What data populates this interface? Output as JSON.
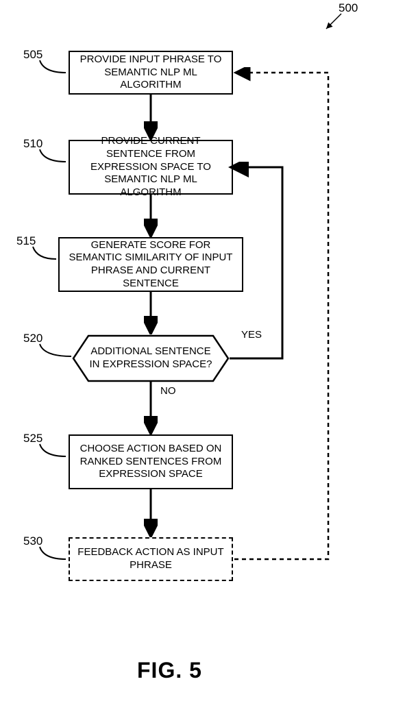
{
  "figure_ref": "500",
  "caption": "FIG. 5",
  "steps": {
    "s505": {
      "ref": "505",
      "text": "PROVIDE INPUT PHRASE TO SEMANTIC NLP ML ALGORITHM"
    },
    "s510": {
      "ref": "510",
      "text": "PROVIDE CURRENT SENTENCE FROM EXPRESSION SPACE TO SEMANTIC NLP ML ALGORITHM"
    },
    "s515": {
      "ref": "515",
      "text": "GENERATE SCORE FOR SEMANTIC SIMILARITY OF INPUT PHRASE AND CURRENT SENTENCE"
    },
    "s520": {
      "ref": "520",
      "text": "ADDITIONAL SENTENCE IN EXPRESSION SPACE?"
    },
    "s525": {
      "ref": "525",
      "text": "CHOOSE ACTION BASED ON RANKED SENTENCES FROM EXPRESSION SPACE"
    },
    "s530": {
      "ref": "530",
      "text": "FEEDBACK ACTION AS INPUT PHRASE"
    }
  },
  "edges": {
    "yes": "YES",
    "no": "NO"
  },
  "chart_data": {
    "type": "flowchart",
    "title": "FIG. 5",
    "reference": "500",
    "nodes": [
      {
        "id": "505",
        "shape": "process",
        "text": "PROVIDE INPUT PHRASE TO SEMANTIC NLP ML ALGORITHM"
      },
      {
        "id": "510",
        "shape": "process",
        "text": "PROVIDE CURRENT SENTENCE FROM EXPRESSION SPACE TO SEMANTIC NLP ML ALGORITHM"
      },
      {
        "id": "515",
        "shape": "process",
        "text": "GENERATE SCORE FOR SEMANTIC SIMILARITY OF INPUT PHRASE AND CURRENT SENTENCE"
      },
      {
        "id": "520",
        "shape": "decision",
        "text": "ADDITIONAL SENTENCE IN EXPRESSION SPACE?"
      },
      {
        "id": "525",
        "shape": "process",
        "text": "CHOOSE ACTION BASED ON RANKED SENTENCES FROM EXPRESSION SPACE"
      },
      {
        "id": "530",
        "shape": "process",
        "text": "FEEDBACK ACTION AS INPUT PHRASE",
        "style": "dashed"
      }
    ],
    "edges": [
      {
        "from": "505",
        "to": "510"
      },
      {
        "from": "510",
        "to": "515"
      },
      {
        "from": "515",
        "to": "520"
      },
      {
        "from": "520",
        "to": "510",
        "label": "YES"
      },
      {
        "from": "520",
        "to": "525",
        "label": "NO"
      },
      {
        "from": "525",
        "to": "530"
      },
      {
        "from": "530",
        "to": "505",
        "style": "dashed"
      }
    ]
  }
}
